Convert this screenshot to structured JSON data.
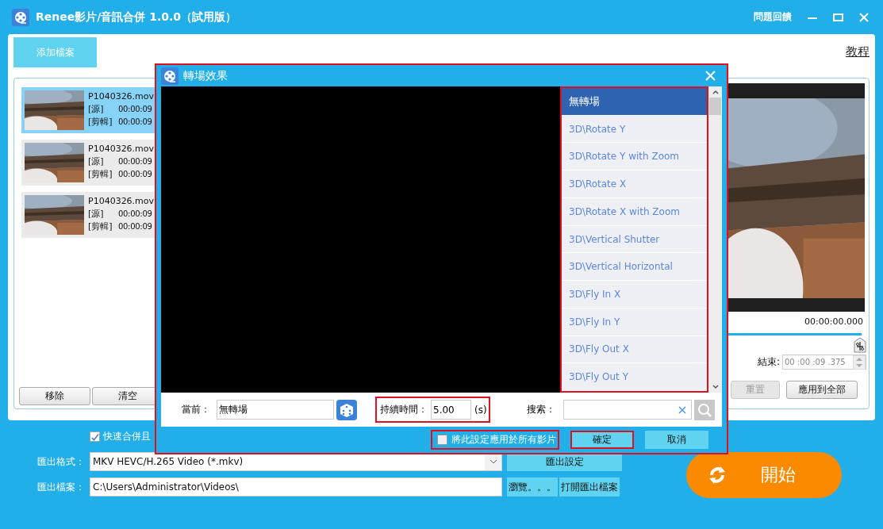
{
  "window": {
    "title": "Renee影片/音訊合併 1.0.0（試用版）",
    "feedback": "問題回饋"
  },
  "toolbar": {
    "add_button": "添加檔案",
    "tutorial_link": "教程"
  },
  "files": [
    {
      "name": "P1040326.mov",
      "source_label": "[源]",
      "source_time": "00:00:09",
      "clip_label": "[剪輯]",
      "clip_time": "00:00:09",
      "selected": true
    },
    {
      "name": "P1040326.mov",
      "source_label": "[源]",
      "source_time": "00:00:09",
      "clip_label": "[剪輯]",
      "clip_time": "00:00:09",
      "selected": false
    },
    {
      "name": "P1040326.mov",
      "source_label": "[源]",
      "source_time": "00:00:09",
      "clip_label": "[剪輯]",
      "clip_time": "00:00:09",
      "selected": false
    }
  ],
  "file_buttons": [
    "移除",
    "清空"
  ],
  "preview": {
    "time": "00:00:00.000",
    "level": 1,
    "end_label": "結束:",
    "end_value": "00 :00 :09 .375",
    "buttons": [
      {
        "label": "重置",
        "disabled": true
      },
      {
        "label": "應用到全部",
        "disabled": false
      }
    ]
  },
  "options": {
    "fast_merge": {
      "label": "快速合併且",
      "checked": true
    },
    "format_label": "匯出格式：",
    "format_value": "MKV HEVC/H.265 Video (*.mkv)",
    "format_settings": "匯出設定",
    "output_label": "匯出檔案：",
    "output_value": "C:\\Users\\Administrator\\Videos\\",
    "browse": "瀏覽。。。",
    "open_folder": "打開匯出檔案",
    "start": "開始"
  },
  "dialog": {
    "title": "轉場效果",
    "highlighted": true,
    "transitions": [
      {
        "label": "無轉場",
        "selected": true
      },
      {
        "label": "3D\\Rotate Y",
        "selected": false
      },
      {
        "label": "3D\\Rotate Y with Zoom",
        "selected": false
      },
      {
        "label": "3D\\Rotate X",
        "selected": false
      },
      {
        "label": "3D\\Rotate X with Zoom",
        "selected": false
      },
      {
        "label": "3D\\Vertical Shutter",
        "selected": false
      },
      {
        "label": "3D\\Vertical Horizontal",
        "selected": false
      },
      {
        "label": "3D\\Fly In X",
        "selected": false
      },
      {
        "label": "3D\\Fly In Y",
        "selected": false
      },
      {
        "label": "3D\\Fly Out X",
        "selected": false
      },
      {
        "label": "3D\\Fly Out Y",
        "selected": false
      }
    ],
    "transitions_highlighted": true,
    "current_label": "當前：",
    "current_value": "無轉場",
    "duration": {
      "label": "持續時間：",
      "value": "5.00",
      "unit": "(s)",
      "highlighted": true
    },
    "search_label": "搜索：",
    "apply_all": {
      "label": "將此設定應用於所有影片",
      "checked": false,
      "highlighted": true
    },
    "ok": {
      "label": "確定",
      "highlighted": true
    },
    "cancel": "取消"
  }
}
